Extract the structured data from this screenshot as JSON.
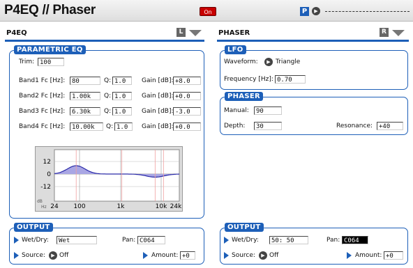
{
  "header": {
    "title": "P4EQ // Phaser",
    "on_label": "On",
    "p_label": "P"
  },
  "left": {
    "section": "P4EQ",
    "badge": "L",
    "parametric": {
      "title": "PARAMETRIC EQ",
      "trim_label": "Trim:",
      "trim_value": "100",
      "bands": [
        {
          "fc_label": "Band1 Fc [Hz]:",
          "fc": "80",
          "q_label": "Q:",
          "q": "1.0",
          "gain_label": "Gain [dB]:",
          "gain": "+8.0"
        },
        {
          "fc_label": "Band2 Fc [Hz]:",
          "fc": "1.00k",
          "q_label": "Q:",
          "q": "1.0",
          "gain_label": "Gain [dB]:",
          "gain": "+0.0"
        },
        {
          "fc_label": "Band3 Fc [Hz]:",
          "fc": "6.30k",
          "q_label": "Q:",
          "q": "1.0",
          "gain_label": "Gain [dB]:",
          "gain": "-3.0"
        },
        {
          "fc_label": "Band4 Fc [Hz]:",
          "fc": "10.00k",
          "q_label": "Q:",
          "q": "1.0",
          "gain_label": "Gain [dB]:",
          "gain": "+0.0"
        }
      ],
      "graph": {
        "y_ticks": [
          "12",
          "0",
          "-12"
        ],
        "x_ticks": [
          "24",
          "100",
          "1k",
          "10k",
          "24k"
        ],
        "y_unit": "dB",
        "x_unit": "Hz",
        "band_freqs_hz": [
          80,
          1000,
          6300,
          10000
        ],
        "curve_color": "#2a2aa8",
        "fill_color": "#a9a6e4"
      }
    },
    "output": {
      "title": "OUTPUT",
      "wetdry_label": "Wet/Dry:",
      "wetdry_value": "Wet",
      "pan_label": "Pan:",
      "pan_value": "C064",
      "source_label": "Source:",
      "source_value": "Off",
      "amount_label": "Amount:",
      "amount_value": "+0"
    }
  },
  "right": {
    "section": "PHASER",
    "badge": "R",
    "lfo": {
      "title": "LFO",
      "waveform_label": "Waveform:",
      "waveform_value": "Triangle",
      "freq_label": "Frequency [Hz]:",
      "freq_value": "0.70"
    },
    "phaser": {
      "title": "PHASER",
      "manual_label": "Manual:",
      "manual_value": "90",
      "depth_label": "Depth:",
      "depth_value": "30",
      "resonance_label": "Resonance:",
      "resonance_value": "+40"
    },
    "output": {
      "title": "OUTPUT",
      "wetdry_label": "Wet/Dry:",
      "wetdry_value": "50: 50",
      "pan_label": "Pan:",
      "pan_value": "C064",
      "source_label": "Source:",
      "source_value": "Off",
      "amount_label": "Amount:",
      "amount_value": "+0"
    }
  },
  "colors": {
    "accent": "#1d5fb8",
    "on_red": "#c80000"
  }
}
